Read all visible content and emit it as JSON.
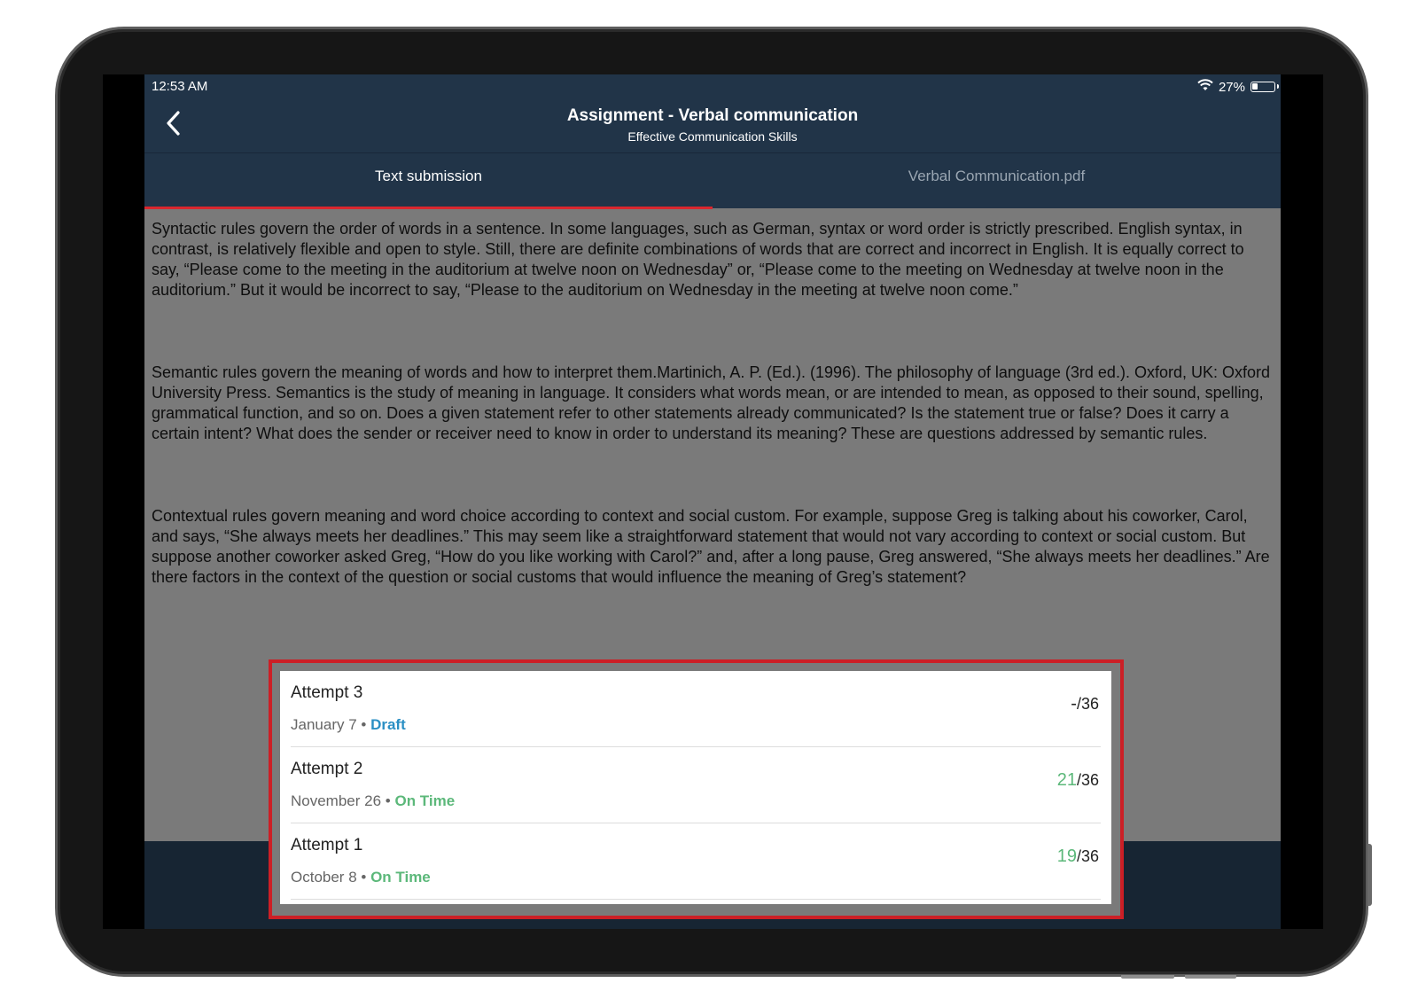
{
  "status_bar": {
    "time": "12:53 AM",
    "battery": "27%",
    "battery_level": 0.27
  },
  "header": {
    "title": "Assignment - Verbal communication",
    "subtitle": "Effective Communication Skills",
    "back_icon": "chevron-left-icon"
  },
  "tabs": [
    {
      "label": "Text submission",
      "active": true
    },
    {
      "label": "Verbal Communication.pdf",
      "active": false
    }
  ],
  "content": {
    "paragraphs": [
      "Syntactic rules govern the order of words in a sentence. In some languages, such as German, syntax or word order is strictly prescribed. English syntax, in contrast, is relatively flexible and open to style. Still, there are definite combinations of words that are correct and incorrect in English. It is equally correct to say, “Please come to the meeting in the auditorium at twelve noon on Wednesday” or, “Please come to the meeting on Wednesday at twelve noon in the auditorium.” But it would be incorrect to say, “Please to the auditorium on Wednesday in the meeting at twelve noon come.”",
      "Semantic rules govern the meaning of words and how to interpret them.Martinich, A. P. (Ed.). (1996). The philosophy of language (3rd ed.). Oxford, UK: Oxford University Press. Semantics is the study of meaning in language. It considers what words mean, or are intended to mean, as opposed to their sound, spelling, grammatical function, and so on. Does a given statement refer to other statements already communicated? Is the statement true or false? Does it carry a certain intent? What does the sender or receiver need to know in order to understand its meaning? These are questions addressed by semantic rules.",
      "Contextual rules govern meaning and word choice according to context and social custom. For example, suppose Greg is talking about his coworker, Carol, and says, “She always meets her deadlines.” This may seem like a straightforward statement that would not vary according to context or social custom. But suppose another coworker asked Greg, “How do you like working with Carol?” and, after a long pause, Greg answered, “She always meets her deadlines.” Are there factors in the context of the question or social customs that would influence the meaning of Greg’s statement?"
    ]
  },
  "attempts": [
    {
      "title": "Attempt 3",
      "date": "January 7",
      "separator": " • ",
      "status": "Draft",
      "score": "-",
      "total": "/36"
    },
    {
      "title": "Attempt 2",
      "date": "November 26",
      "separator": " • ",
      "status": "On Time",
      "score": "21",
      "total": "/36"
    },
    {
      "title": "Attempt 1",
      "date": "October 8",
      "separator": " • ",
      "status": "On Time",
      "score": "19",
      "total": "/36"
    }
  ],
  "colors": {
    "header_bg": "#213448",
    "tab_indicator": "#d9272e",
    "highlight_border": "#cc1f26",
    "draft": "#2a8fc4",
    "on_time": "#5cb87a",
    "score_green": "#5cb87a"
  }
}
